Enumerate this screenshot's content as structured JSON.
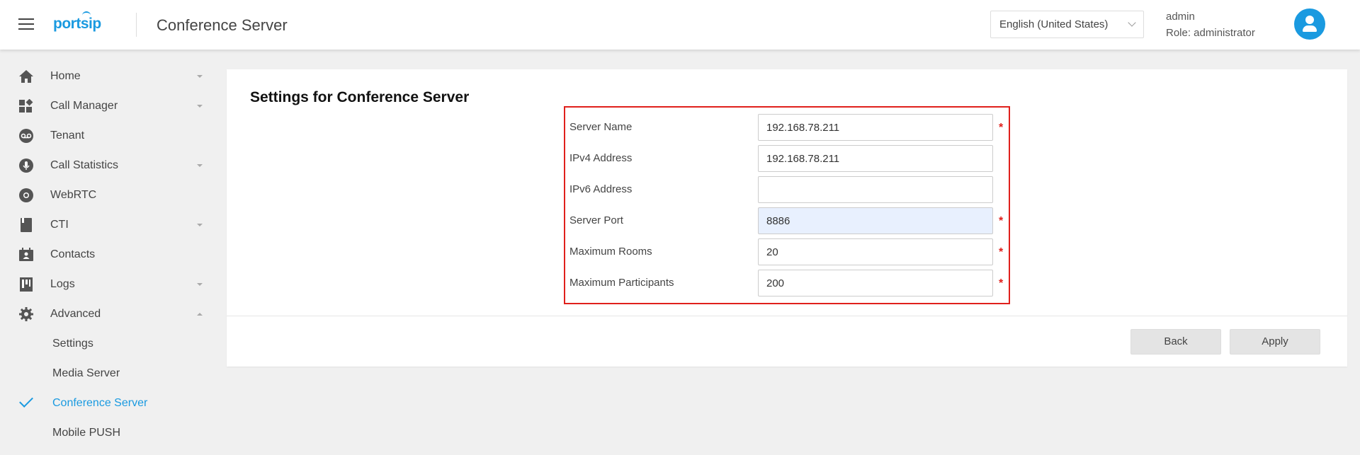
{
  "header": {
    "logo": "portsip",
    "title": "Conference Server",
    "language": "English (United States)",
    "user_name": "admin",
    "user_role": "Role: administrator"
  },
  "sidebar": {
    "items": [
      {
        "label": "Home",
        "icon": "home-icon"
      },
      {
        "label": "Call Manager",
        "icon": "widgets-icon"
      },
      {
        "label": "Tenant",
        "icon": "voicemail-icon"
      },
      {
        "label": "Call Statistics",
        "icon": "microphone-icon"
      },
      {
        "label": "WebRTC",
        "icon": "chrome-icon"
      },
      {
        "label": "CTI",
        "icon": "book-icon"
      },
      {
        "label": "Contacts",
        "icon": "contacts-icon"
      },
      {
        "label": "Logs",
        "icon": "logs-icon"
      },
      {
        "label": "Advanced",
        "icon": "gear-icon"
      }
    ],
    "sub_items": [
      {
        "label": "Settings"
      },
      {
        "label": "Media Server"
      },
      {
        "label": "Conference Server"
      },
      {
        "label": "Mobile PUSH"
      }
    ]
  },
  "main": {
    "title": "Settings for Conference Server",
    "required_mark": "*",
    "fields": [
      {
        "label": "Server Name",
        "value": "192.168.78.211"
      },
      {
        "label": "IPv4 Address",
        "value": "192.168.78.211"
      },
      {
        "label": "IPv6 Address",
        "value": ""
      },
      {
        "label": "Server Port",
        "value": "8886"
      },
      {
        "label": "Maximum Rooms",
        "value": "20"
      },
      {
        "label": "Maximum Participants",
        "value": "200"
      }
    ],
    "back_label": "Back",
    "apply_label": "Apply"
  },
  "colors": {
    "accent": "#1a9ae0",
    "highlight_border": "#e0201c",
    "background": "#f0f0f0"
  }
}
